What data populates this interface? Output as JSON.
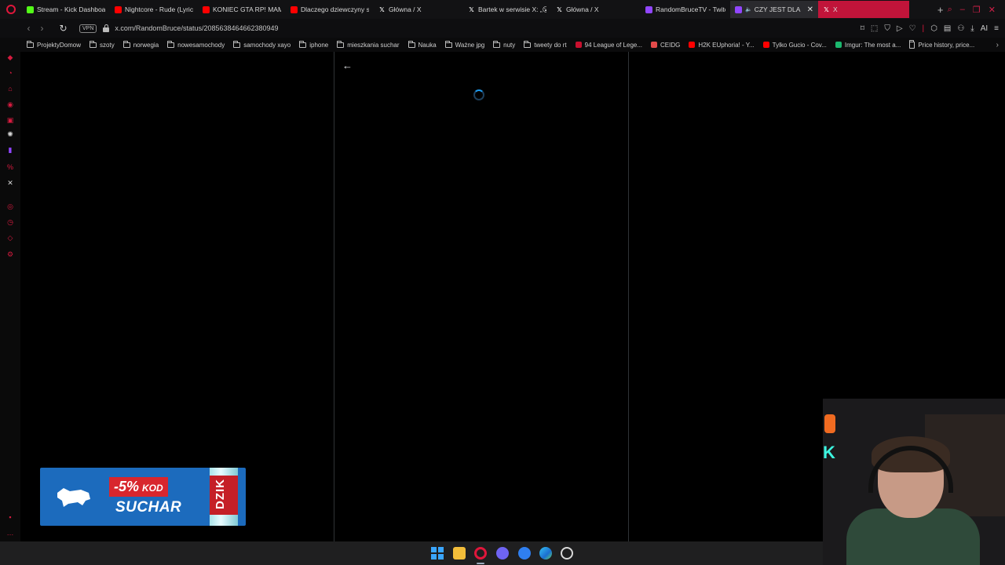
{
  "browser": {
    "tabs": [
      {
        "title": "Stream - Kick Dashboard",
        "icon": "kick-icon",
        "color": "#53fc18"
      },
      {
        "title": "Nightcore - Rude (Lyrics)",
        "icon": "youtube-icon",
        "color": "#ff0000"
      },
      {
        "title": "KONIEC GTA RP! MAMM",
        "icon": "youtube-icon",
        "color": "#ff0000"
      },
      {
        "title": "Dlaczego dziewczyny sa",
        "icon": "youtube-icon",
        "color": "#ff0000"
      },
      {
        "title": "Główna / X",
        "icon": "x-icon",
        "color": "#ffffff"
      },
      {
        "title": "Bartek w serwisie X: „😮",
        "icon": "x-icon",
        "color": "#ffffff"
      },
      {
        "title": "Główna / X",
        "icon": "x-icon",
        "color": "#ffffff"
      },
      {
        "title": "RandomBruceTV - Twitch",
        "icon": "twitch-icon",
        "color": "#9146ff"
      },
      {
        "title": "CZY JEST DLA M",
        "icon": "twitch-icon",
        "color": "#9146ff",
        "state": "active",
        "audio": true
      },
      {
        "title": "X",
        "icon": "x-icon",
        "color": "#ffffff",
        "state": "highlight"
      }
    ],
    "new_tab_label": "+",
    "address": {
      "vpn_label": "VPN",
      "url": "x.com/RandomBruce/status/2085638464662380949"
    },
    "toolbar_extra_label": "AI",
    "bookmarks": [
      {
        "label": "ProjektyDomow",
        "type": "folder"
      },
      {
        "label": "szoty",
        "type": "folder"
      },
      {
        "label": "norwegia",
        "type": "folder"
      },
      {
        "label": "nowesamochody",
        "type": "folder"
      },
      {
        "label": "samochody xayo",
        "type": "folder"
      },
      {
        "label": "iphone",
        "type": "folder"
      },
      {
        "label": "mieszkania suchar",
        "type": "folder"
      },
      {
        "label": "Nauka",
        "type": "folder"
      },
      {
        "label": "Ważne jpg",
        "type": "folder"
      },
      {
        "label": "nuty",
        "type": "folder"
      },
      {
        "label": "tweety do rt",
        "type": "folder"
      },
      {
        "label": "94 League of Lege...",
        "type": "site",
        "color": "#c8102e"
      },
      {
        "label": "CEIDG",
        "type": "site",
        "color": "#e34a4a"
      },
      {
        "label": "H2K EUphoria! - Y...",
        "type": "site",
        "color": "#ff0000"
      },
      {
        "label": "Tylko Gucio - Cov...",
        "type": "site",
        "color": "#ff0000"
      },
      {
        "label": "Imgur: The most a...",
        "type": "site",
        "color": "#1bb76e"
      },
      {
        "label": "Price history, price...",
        "type": "page"
      }
    ]
  },
  "ad": {
    "discount": "-5%",
    "kod": "KOD",
    "code": "SUCHAR",
    "can_brand": "DZIK",
    "colors": {
      "bg": "#1c6bbd",
      "accent": "#d8262d"
    }
  },
  "colors": {
    "brand": "#e0163b",
    "x_blue": "#1d9bf0"
  }
}
